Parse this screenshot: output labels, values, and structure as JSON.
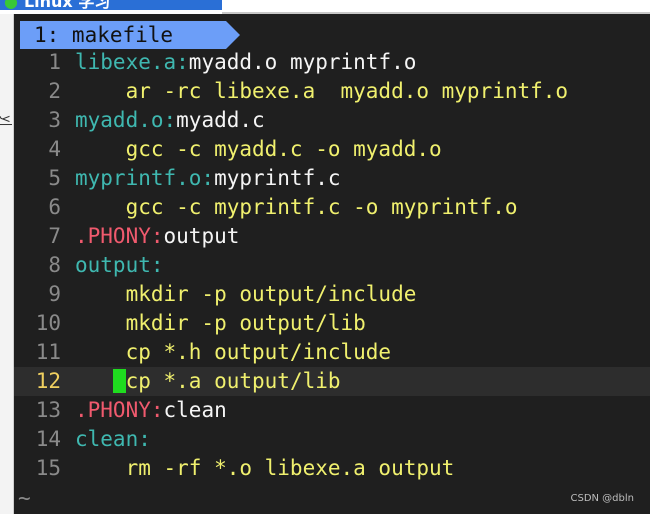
{
  "window": {
    "tab_title": "Linux 学习",
    "gutter_char": "y|"
  },
  "editor": {
    "buffer_tab": "1: makefile",
    "empty_line_marker": "~",
    "lines": [
      {
        "n": "1",
        "parts": [
          {
            "t": "libexe.a:",
            "c": "tgt"
          },
          {
            "t": "myadd.o myprintf.o",
            "c": "txt"
          }
        ]
      },
      {
        "n": "2",
        "parts": [
          {
            "t": "    ar -rc libexe.a  myadd.o myprintf.o",
            "c": "cmd"
          }
        ]
      },
      {
        "n": "3",
        "parts": [
          {
            "t": "myadd.o:",
            "c": "tgt"
          },
          {
            "t": "myadd.c",
            "c": "txt"
          }
        ]
      },
      {
        "n": "4",
        "parts": [
          {
            "t": "    gcc -c myadd.c -o myadd.o",
            "c": "cmd"
          }
        ]
      },
      {
        "n": "5",
        "parts": [
          {
            "t": "myprintf.o:",
            "c": "tgt"
          },
          {
            "t": "myprintf.c",
            "c": "txt"
          }
        ]
      },
      {
        "n": "6",
        "parts": [
          {
            "t": "    gcc -c myprintf.c -o myprintf.o",
            "c": "cmd"
          }
        ]
      },
      {
        "n": "7",
        "parts": [
          {
            "t": ".PHONY:",
            "c": "phony"
          },
          {
            "t": "output",
            "c": "txt"
          }
        ]
      },
      {
        "n": "8",
        "parts": [
          {
            "t": "output:",
            "c": "tgt"
          }
        ]
      },
      {
        "n": "9",
        "parts": [
          {
            "t": "    mkdir -p output/include",
            "c": "cmd"
          }
        ]
      },
      {
        "n": "10",
        "parts": [
          {
            "t": "    mkdir -p output/lib",
            "c": "cmd"
          }
        ]
      },
      {
        "n": "11",
        "parts": [
          {
            "t": "    cp *.h output/include",
            "c": "cmd"
          }
        ]
      },
      {
        "n": "12",
        "current": true,
        "parts": [
          {
            "t": "   ",
            "c": "cmd"
          },
          {
            "t": " ",
            "c": "cursor"
          },
          {
            "t": "cp *.a output/lib",
            "c": "cmd"
          }
        ]
      },
      {
        "n": "13",
        "parts": [
          {
            "t": ".PHONY:",
            "c": "phony"
          },
          {
            "t": "clean",
            "c": "txt"
          }
        ]
      },
      {
        "n": "14",
        "parts": [
          {
            "t": "clean:",
            "c": "tgt"
          }
        ]
      },
      {
        "n": "15",
        "parts": [
          {
            "t": "    rm -rf *.o libexe.a output",
            "c": "cmd"
          }
        ]
      }
    ]
  },
  "watermark": "CSDN @dbln",
  "colors": {
    "background": "#1f1f1f",
    "target": "#3fb8b0",
    "phony": "#f05a6e",
    "command": "#f0f06e",
    "plain": "#f5f5f5",
    "cursor": "#1fdc1f",
    "tab": "#6c9ef8"
  }
}
